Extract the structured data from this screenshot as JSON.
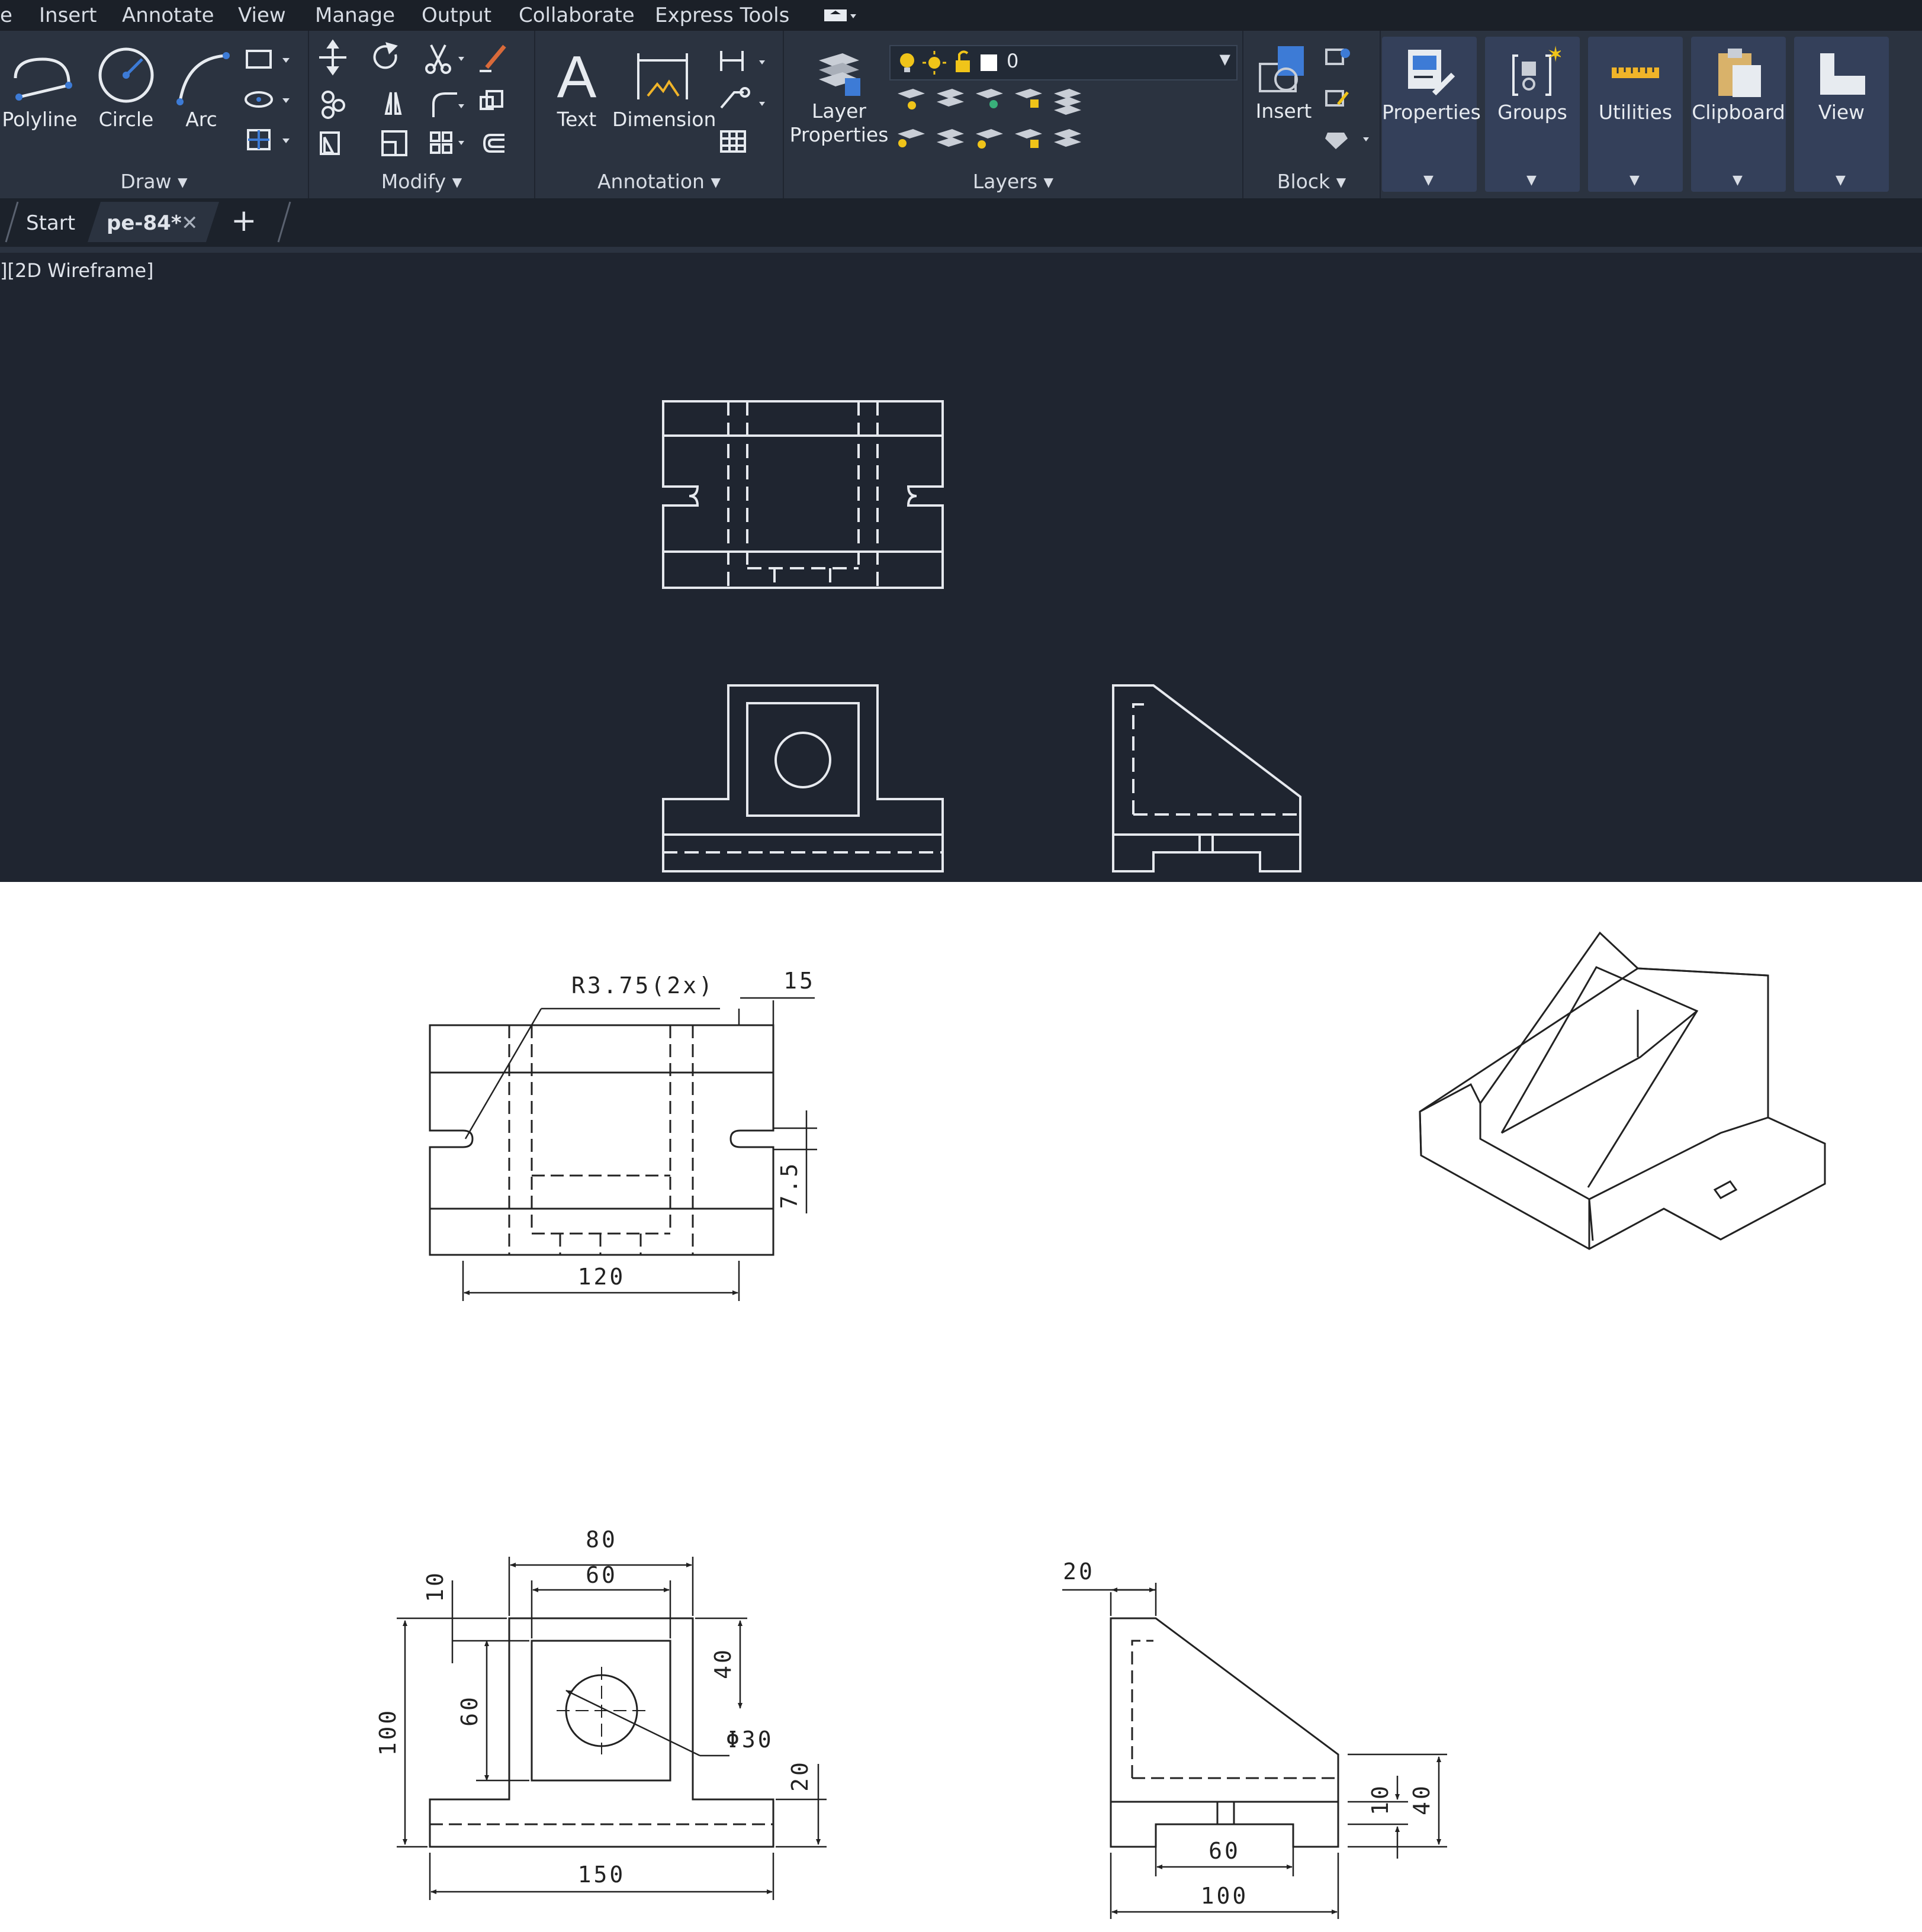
{
  "menubar": {
    "items": [
      "e",
      "Insert",
      "Annotate",
      "View",
      "Manage",
      "Output",
      "Collaborate",
      "Express Tools"
    ]
  },
  "ribbon": {
    "draw": {
      "title": "Draw",
      "polyline": "Polyline",
      "circle": "Circle",
      "arc": "Arc"
    },
    "modify": {
      "title": "Modify"
    },
    "annotation": {
      "title": "Annotation",
      "text": "Text",
      "dimension": "Dimension"
    },
    "layers": {
      "title": "Layers",
      "layer_properties_line1": "Layer",
      "layer_properties_line2": "Properties",
      "current_layer": "0"
    },
    "block": {
      "title": "Block",
      "insert": "Insert"
    },
    "properties": "Properties",
    "groups": "Groups",
    "utilities": "Utilities",
    "clipboard": "Clipboard",
    "view": "View"
  },
  "tabs": {
    "start": "Start",
    "drawing": "pe-84*",
    "close": "✕",
    "add": "+"
  },
  "viewport": {
    "label": "][2D Wireframe]"
  },
  "reference": {
    "top_view": {
      "radius_note": "R3.75(2x)",
      "dim_15": "15",
      "dim_7_5": "7.5",
      "dim_120": "120"
    },
    "front_view": {
      "dim_80": "80",
      "dim_60": "60",
      "dim_10": "10",
      "dim_100": "100",
      "dim_60_v": "60",
      "dim_40": "40",
      "hole": "Φ30",
      "dim_20": "20",
      "dim_150": "150"
    },
    "side_view": {
      "dim_20": "20",
      "dim_10": "10",
      "dim_40": "40",
      "dim_60": "60",
      "dim_100": "100"
    }
  },
  "colors": {
    "ribbon": "#2b3340",
    "canvas": "#1f2530",
    "tile": "#34405a",
    "accent": "#3d7bd6"
  }
}
